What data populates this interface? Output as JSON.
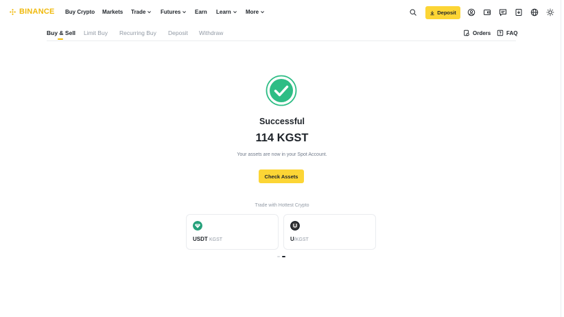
{
  "brand": {
    "name": "BINANCE",
    "color": "#f0b90b",
    "accent": "#fcd535"
  },
  "nav": {
    "items": [
      {
        "label": "Buy Crypto",
        "dropdown": false
      },
      {
        "label": "Markets",
        "dropdown": false
      },
      {
        "label": "Trade",
        "dropdown": true
      },
      {
        "label": "Futures",
        "dropdown": true
      },
      {
        "label": "Earn",
        "dropdown": false
      },
      {
        "label": "Learn",
        "dropdown": true
      },
      {
        "label": "More",
        "dropdown": true
      }
    ],
    "deposit_label": "Deposit",
    "icons": [
      "search-icon",
      "profile-icon",
      "wallet-icon",
      "messages-icon",
      "download-icon",
      "language-icon",
      "theme-icon"
    ]
  },
  "subtabs": {
    "tabs": [
      "Buy & Sell",
      "Limit Buy",
      "Recurring Buy",
      "Deposit",
      "Withdraw"
    ],
    "active": "Buy & Sell",
    "orders_label": "Orders",
    "faq_label": "FAQ"
  },
  "result": {
    "status": "Successful",
    "amount": "114 KGST",
    "note": "Your assets are now in your Spot Account.",
    "button": "Check Assets",
    "success_color": "#2ebd85"
  },
  "hottest": {
    "title": "Trade with Hottest Crypto",
    "cards": [
      {
        "base": "USDT",
        "quote": "KGST",
        "icon": "tether-icon",
        "icon_color": "#26a17b"
      },
      {
        "base": "U",
        "quote": "/KGST",
        "icon": "u-coin-icon",
        "icon_color": "#1e2329"
      }
    ]
  }
}
